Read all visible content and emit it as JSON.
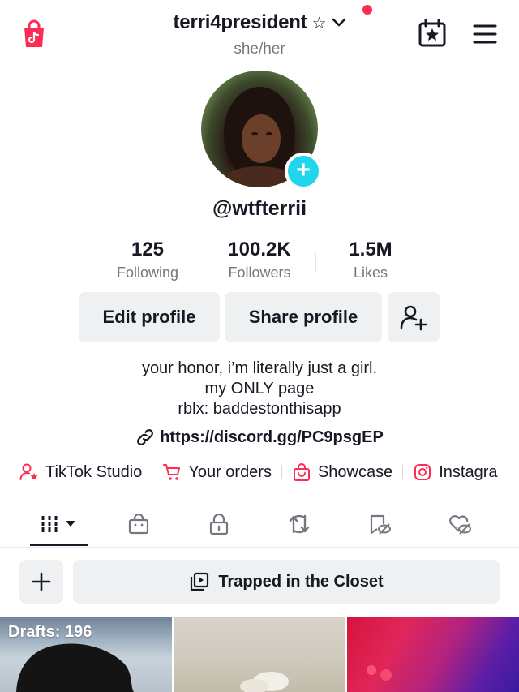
{
  "header": {
    "username": "terri4president",
    "username_suffix": "☆",
    "pronouns": "she/her",
    "notification_dot_color": "#fe2c55",
    "icons": [
      "shop-icon",
      "chevron-down-icon",
      "calendar-star-icon",
      "hamburger-menu-icon"
    ]
  },
  "profile": {
    "handle": "@wtfterrii",
    "add_badge": "+"
  },
  "stats": [
    {
      "value": "125",
      "label": "Following"
    },
    {
      "value": "100.2K",
      "label": "Followers"
    },
    {
      "value": "1.5M",
      "label": "Likes"
    }
  ],
  "actions": {
    "edit_profile": "Edit profile",
    "share_profile": "Share profile",
    "add_friends_icon": "add-person-icon"
  },
  "bio": {
    "lines": [
      "your honor, i’m literally just a girl.",
      "my ONLY page",
      "rblx: baddestonthisapp"
    ],
    "link": "https://discord.gg/PC9psgEP"
  },
  "shortcuts": [
    {
      "label": "TikTok Studio",
      "icon": "person-star-icon"
    },
    {
      "label": "Your orders",
      "icon": "cart-icon"
    },
    {
      "label": "Showcase",
      "icon": "bag-icon"
    },
    {
      "label": "Instagra",
      "icon": "instagram-icon"
    }
  ],
  "tabs": [
    {
      "name": "videos",
      "icon": "grid-icon",
      "active": true
    },
    {
      "name": "shop",
      "icon": "shop-bag-icon"
    },
    {
      "name": "private",
      "icon": "lock-icon"
    },
    {
      "name": "reposts",
      "icon": "repost-icon"
    },
    {
      "name": "favorites",
      "icon": "bookmark-hidden-icon"
    },
    {
      "name": "liked",
      "icon": "heart-hidden-icon"
    }
  ],
  "collection": {
    "add_label": "+",
    "title": "Trapped in the Closet"
  },
  "grid": {
    "drafts_label": "Drafts: 196"
  },
  "colors": {
    "accent_pink": "#fe2c55",
    "badge_cyan": "#20d5ec",
    "button_bg": "#eff0f1"
  }
}
